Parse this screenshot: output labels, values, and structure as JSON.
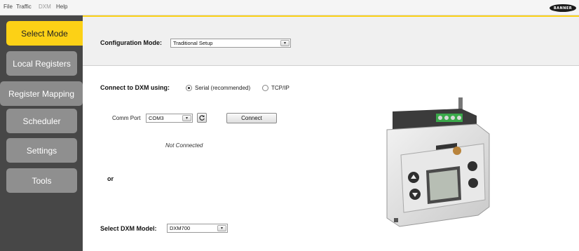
{
  "menu": {
    "file": "File",
    "traffic": "Traffic",
    "dxm": "DXM",
    "help": "Help"
  },
  "brand": "BANNER",
  "sidebar": {
    "items": [
      {
        "label": "Select Mode"
      },
      {
        "label": "Local Registers"
      },
      {
        "label": "Register Mapping"
      },
      {
        "label": "Scheduler"
      },
      {
        "label": "Settings"
      },
      {
        "label": "Tools"
      }
    ],
    "active_index": 0
  },
  "config": {
    "label": "Configuration Mode:",
    "value": "Traditional Setup"
  },
  "connect": {
    "label": "Connect to DXM using:",
    "options": [
      "Serial (recommended)",
      "TCP/IP"
    ],
    "selected": "Serial (recommended)",
    "comm_port_label": "Comm Port",
    "comm_port_value": "COM3",
    "connect_button": "Connect",
    "status": "Not Connected",
    "or_label": "or"
  },
  "model": {
    "label": "Select DXM Model:",
    "value": "DXM700"
  },
  "colors": {
    "accent": "#fcd116",
    "sidebar_bg": "#474747",
    "nav_bg": "#8f8f8f"
  }
}
